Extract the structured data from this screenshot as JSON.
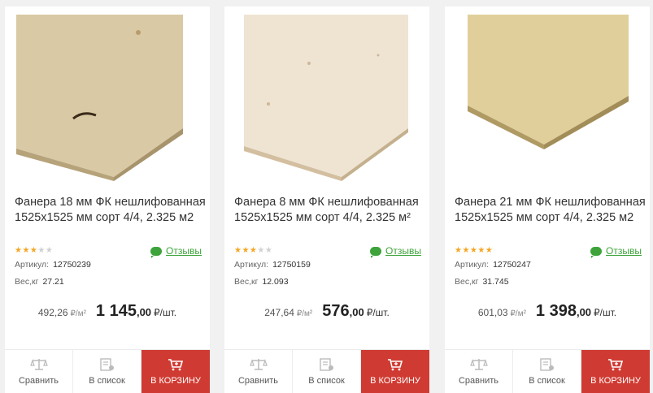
{
  "products": [
    {
      "title": "Фанера 18 мм ФК нешлифованная 1525x1525 мм сорт 4/4, 2.325 м2",
      "rating": 3,
      "reviews_label": "Отзывы",
      "article_label": "Артикул:",
      "article": "12750239",
      "weight_label": "Вес,кг",
      "weight": "27.21",
      "old_price": "492,26",
      "old_unit": "₽/м²",
      "price_int": "1 145",
      "price_cents": ",00",
      "price_unit": "₽/шт.",
      "compare_label": "Сравнить",
      "list_label": "В список",
      "cart_label": "В КОРЗИНУ"
    },
    {
      "title": "Фанера 8 мм ФК нешлифованная 1525x1525 мм сорт 4/4, 2.325 м²",
      "rating": 3,
      "reviews_label": "Отзывы",
      "article_label": "Артикул:",
      "article": "12750159",
      "weight_label": "Вес,кг",
      "weight": "12.093",
      "old_price": "247,64",
      "old_unit": "₽/м²",
      "price_int": "576",
      "price_cents": ",00",
      "price_unit": "₽/шт.",
      "compare_label": "Сравнить",
      "list_label": "В список",
      "cart_label": "В КОРЗИНУ"
    },
    {
      "title": "Фанера 21 мм ФК нешлифованная 1525x1525 мм сорт 4/4, 2.325 м2",
      "rating": 5,
      "reviews_label": "Отзывы",
      "article_label": "Артикул:",
      "article": "12750247",
      "weight_label": "Вес,кг",
      "weight": "31.745",
      "old_price": "601,03",
      "old_unit": "₽/м²",
      "price_int": "1 398",
      "price_cents": ",00",
      "price_unit": "₽/шт.",
      "compare_label": "Сравнить",
      "list_label": "В список",
      "cart_label": "В КОРЗИНУ"
    }
  ],
  "colors": {
    "accent_red": "#cf3b32",
    "reviews_green": "#3da33a",
    "star": "#f5a623"
  },
  "icons": {
    "compare": "scales-icon",
    "list": "list-document-icon",
    "cart": "cart-icon",
    "reviews": "speech-bubble-icon",
    "rating": "star-icon"
  }
}
